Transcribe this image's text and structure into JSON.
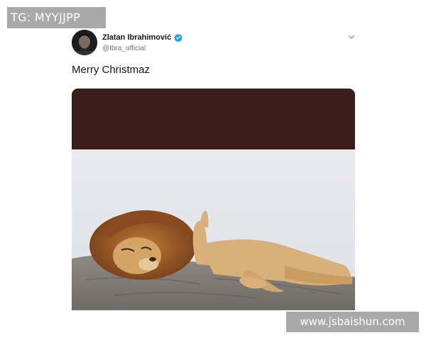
{
  "watermarks": {
    "top": "TG: MYYJJPP",
    "bottom": "www.jsbaishun.com"
  },
  "tweet": {
    "display_name": "Zlatan Ibrahimović",
    "handle": "@Ibra_official",
    "text": "Merry Christmaz",
    "verified": true,
    "menu_icon": "chevron-down-icon",
    "colors": {
      "verified": "#1da1f2",
      "handle": "#657786",
      "text": "#14171a",
      "media_header": "#3b1e1c"
    }
  }
}
